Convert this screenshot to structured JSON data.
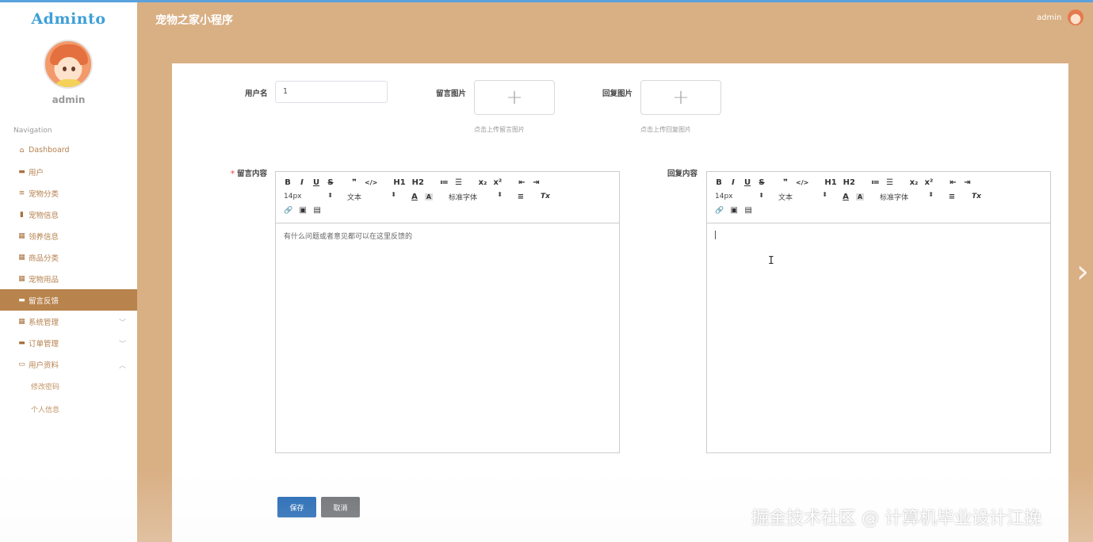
{
  "sidebar": {
    "logo": "Adminto",
    "admin_name": "admin",
    "nav_heading": "Navigation",
    "items": [
      {
        "label": "Dashboard",
        "icon": "home-icon",
        "glyph": "⌂"
      },
      {
        "label": "用户",
        "icon": "user-card-icon",
        "glyph": "▬"
      },
      {
        "label": "宠物分类",
        "icon": "list-icon",
        "glyph": "≡"
      },
      {
        "label": "宠物信息",
        "icon": "bar-chart-icon",
        "glyph": "▮"
      },
      {
        "label": "领养信息",
        "icon": "grid-icon",
        "glyph": "▦"
      },
      {
        "label": "商品分类",
        "icon": "grid-icon",
        "glyph": "▦"
      },
      {
        "label": "宠物用品",
        "icon": "grid-icon",
        "glyph": "▦"
      },
      {
        "label": "留言反馈",
        "icon": "lock-icon",
        "glyph": "▬",
        "active": true
      },
      {
        "label": "系统管理",
        "icon": "grid-icon",
        "glyph": "▦",
        "chevron": "﹀"
      },
      {
        "label": "订单管理",
        "icon": "order-icon",
        "glyph": "▬",
        "chevron": "﹀"
      },
      {
        "label": "用户资料",
        "icon": "profile-icon",
        "glyph": "▭",
        "chevron": "︿"
      }
    ],
    "sub_items": [
      "修改密码",
      "个人信息"
    ]
  },
  "header": {
    "title": "宠物之家小程序",
    "user": "admin"
  },
  "form": {
    "username_label": "用户名",
    "username_value": "1",
    "message_image_label": "留言图片",
    "message_image_hint": "点击上传留言图片",
    "reply_image_label": "回复图片",
    "reply_image_hint": "点击上传回复图片",
    "upload_plus": "+",
    "message_content_label": "留言内容",
    "required_mark": "*",
    "message_content": "有什么问题或者意见都可以在这里反馈的",
    "reply_content_label": "回复内容",
    "save_label": "保存",
    "cancel_label": "取消"
  },
  "editor_toolbar": {
    "row1": [
      "B",
      "I",
      "U",
      "S",
      "❞",
      "</>",
      "H1",
      "H2",
      "≔",
      "☰",
      "x₂",
      "x²",
      "⇤",
      "⇥"
    ],
    "font_size": "14px",
    "text_type": "文本",
    "font_family": "标准字体",
    "color_glyph": "A",
    "bg_glyph": "A",
    "align_glyph": "≡",
    "clear_glyph": "Tx",
    "row3": [
      "🔗",
      "▣",
      "▤"
    ]
  },
  "watermark": "掘金技术社区 @ 计算机毕业设计江挽"
}
